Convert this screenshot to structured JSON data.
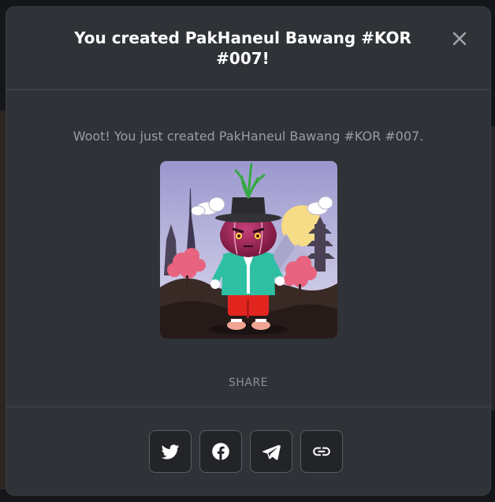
{
  "modal": {
    "title": "You created PakHaneul Bawang #KOR #007!",
    "message": "Woot! You just created PakHaneul Bawang #KOR #007.",
    "share_label": "SHARE",
    "close_icon": "close-icon",
    "image": {
      "subject": "onion-character-with-gat-hat",
      "icon": "nft-artwork"
    }
  },
  "share_buttons": [
    {
      "icon": "twitter-icon"
    },
    {
      "icon": "facebook-icon"
    },
    {
      "icon": "telegram-icon"
    },
    {
      "icon": "link-icon"
    }
  ],
  "colors": {
    "modal_bg": "#2f3237",
    "title": "#ffffff",
    "text_muted": "#9a9da3",
    "button_bg": "#222428",
    "button_border": "#5a5d63"
  }
}
